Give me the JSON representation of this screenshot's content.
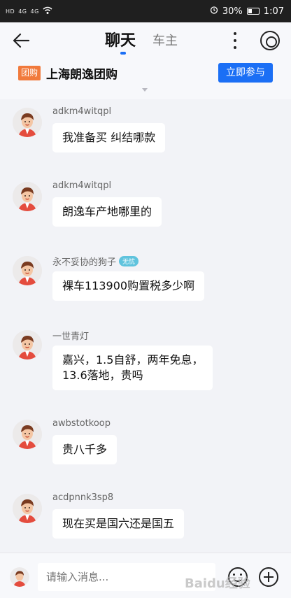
{
  "status_bar": {
    "left_icons": [
      "HD",
      "4G",
      "4G",
      "wifi"
    ],
    "battery": "30%",
    "time": "1:07"
  },
  "header": {
    "tabs": [
      {
        "label": "聊天",
        "active": true
      },
      {
        "label": "车主",
        "active": false
      }
    ],
    "icons": {
      "back": "back-arrow-icon",
      "more": "more-vertical-icon",
      "target": "target-icon"
    }
  },
  "group": {
    "tag": "团购",
    "title": "上海朗逸团购",
    "button": "立即参与"
  },
  "messages": [
    {
      "user": "adkm4witqpl",
      "badge": "",
      "text": "我准备买 纠结哪款"
    },
    {
      "user": "adkm4witqpl",
      "badge": "",
      "text": "朗逸车产地哪里的"
    },
    {
      "user": "永不妥协的狗子",
      "badge": "无忧",
      "text": "裸车113900购置税多少啊"
    },
    {
      "user": "一世青灯",
      "badge": "",
      "text": "嘉兴，1.5自舒，两年免息，\n13.6落地，贵吗"
    },
    {
      "user": "awbstotkoop",
      "badge": "",
      "text": "贵八千多"
    },
    {
      "user": "acdpnnk3sp8",
      "badge": "",
      "text": "现在买是国六还是国五"
    }
  ],
  "input": {
    "placeholder": "请输入消息..."
  },
  "watermark": "Baidu经验",
  "colors": {
    "accent": "#1b6ff5",
    "tag": "#f17a3c",
    "badge": "#5fc3dd"
  }
}
